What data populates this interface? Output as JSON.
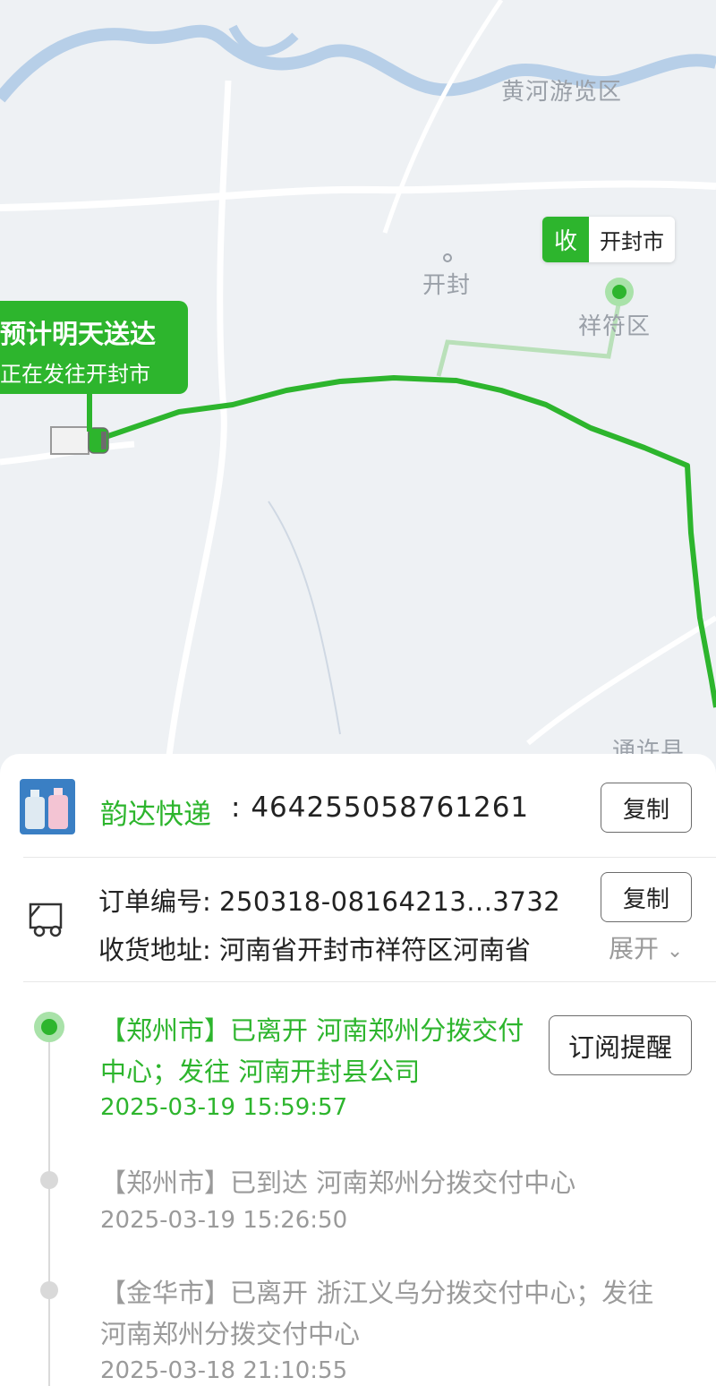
{
  "map": {
    "labels": {
      "huanghe": "黄河游览区",
      "kaifeng": "开封",
      "xiangfu": "祥符区",
      "tongxu": "通许县"
    },
    "eta_bubble": {
      "title": "预计明天送达",
      "subtitle": "正在发往开封市"
    },
    "destination": {
      "tag": "收",
      "city": "开封市"
    }
  },
  "shipment": {
    "courier": "韵达快递",
    "colon": ":",
    "tracking_number": "464255058761261",
    "copy_label": "复制"
  },
  "order": {
    "order_label": "订单编号:",
    "order_value": "250318-08164213...3732",
    "copy_label": "复制",
    "address_label": "收货地址:",
    "address_value": "河南省开封市祥符区河南省",
    "expand_label": "展开"
  },
  "subscribe_label": "订阅提醒",
  "events": [
    {
      "text": "【郑州市】已离开 河南郑州分拨交付中心；发往 河南开封县公司",
      "time": "2025-03-19 15:59:57"
    },
    {
      "text": "【郑州市】已到达 河南郑州分拨交付中心",
      "time": "2025-03-19 15:26:50"
    },
    {
      "text": "【金华市】已离开 浙江义乌分拨交付中心；发往 河南郑州分拨交付中心",
      "time": "2025-03-18 21:10:55"
    }
  ],
  "colors": {
    "accent": "#2db52d",
    "map_bg": "#eef1f4",
    "river": "#b7cfe8",
    "muted_text": "#9a9a9a"
  }
}
